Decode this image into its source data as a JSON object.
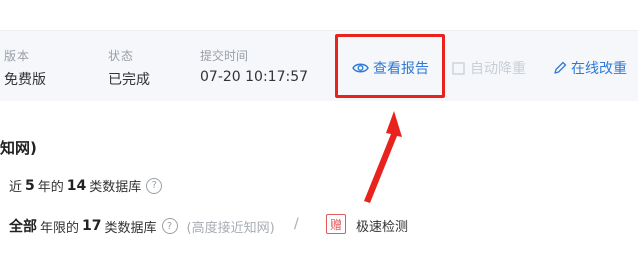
{
  "record": {
    "version_header": "版本",
    "version_value": "免费版",
    "status_header": "状态",
    "status_value": "已完成",
    "time_header": "提交时间",
    "time_value": "07-20 10:17:57"
  },
  "actions": {
    "view_report": "查看报告",
    "auto_reduce": "自动降重",
    "online_edit": "在线改重"
  },
  "section": {
    "title": "知网)",
    "line1_pre": "近",
    "line1_num": "5",
    "line1_mid": "年的",
    "line1_count": "14",
    "line1_post": "类数据库",
    "line2_all": "全部",
    "line2_mid": "年限的",
    "line2_count": "17",
    "line2_post": "类数据库",
    "line2_note": "(高度接近知网)",
    "separator": "/",
    "gift_badge": "赠",
    "gift_label": "极速检测"
  },
  "colors": {
    "accent": "#2f7ad6",
    "highlight_box": "#e8231e",
    "disabled": "#c9cfd7"
  }
}
